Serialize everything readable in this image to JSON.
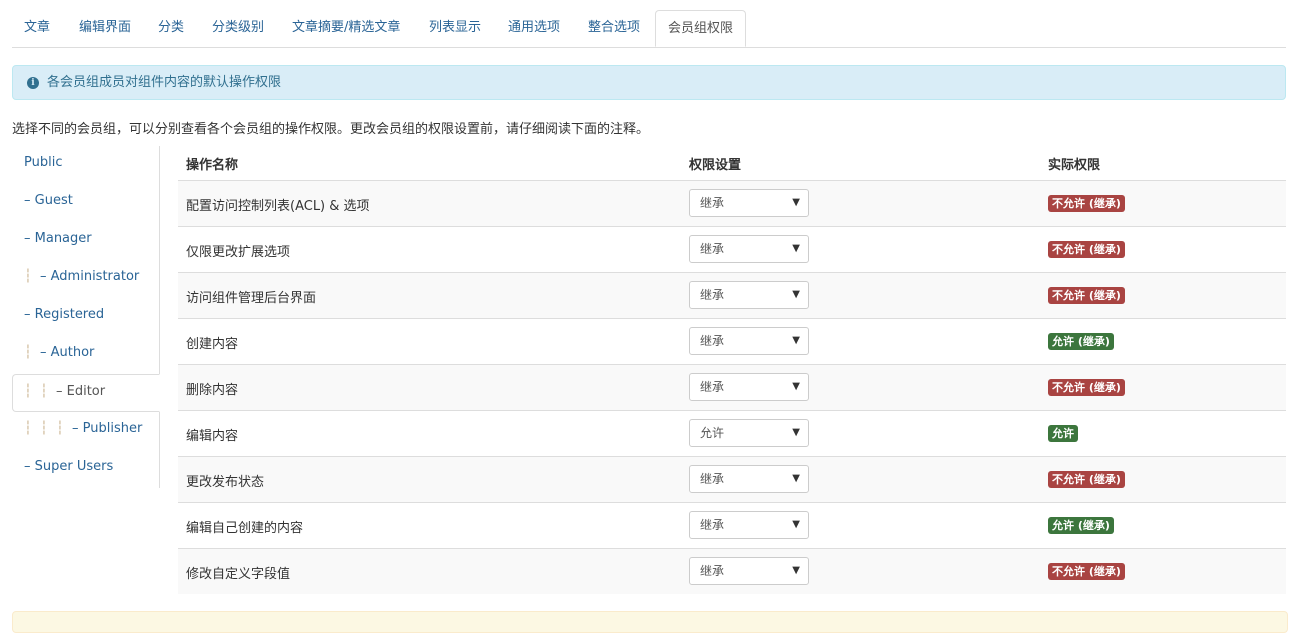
{
  "tabs": [
    "文章",
    "编辑界面",
    "分类",
    "分类级别",
    "文章摘要/精选文章",
    "列表显示",
    "通用选项",
    "整合选项",
    "会员组权限"
  ],
  "alert": {
    "icon": "info-icon",
    "text": "各会员组成员对组件内容的默认操作权限"
  },
  "description": "选择不同的会员组，可以分别查看各个会员组的操作权限。更改会员组的权限设置前，请仔细阅读下面的注释。",
  "groups": [
    {
      "label": "Public",
      "level": 0
    },
    {
      "label": "– Guest",
      "level": 0
    },
    {
      "label": "– Manager",
      "level": 0
    },
    {
      "label": "– Administrator",
      "level": 1
    },
    {
      "label": "– Registered",
      "level": 0
    },
    {
      "label": "– Author",
      "level": 1
    },
    {
      "label": "– Editor",
      "level": 2
    },
    {
      "label": "– Publisher",
      "level": 3
    },
    {
      "label": "– Super Users",
      "level": 0
    }
  ],
  "table": {
    "headers": {
      "action": "操作名称",
      "setting": "权限设置",
      "actual": "实际权限"
    },
    "rows": [
      {
        "action": "配置访问控制列表(ACL) & 选项",
        "setting": "继承",
        "actual": "不允许 (继承)",
        "status": "deny"
      },
      {
        "action": "仅限更改扩展选项",
        "setting": "继承",
        "actual": "不允许 (继承)",
        "status": "deny"
      },
      {
        "action": "访问组件管理后台界面",
        "setting": "继承",
        "actual": "不允许 (继承)",
        "status": "deny"
      },
      {
        "action": "创建内容",
        "setting": "继承",
        "actual": "允许 (继承)",
        "status": "allow"
      },
      {
        "action": "删除内容",
        "setting": "继承",
        "actual": "不允许 (继承)",
        "status": "deny"
      },
      {
        "action": "编辑内容",
        "setting": "允许",
        "actual": "允许",
        "status": "allow"
      },
      {
        "action": "更改发布状态",
        "setting": "继承",
        "actual": "不允许 (继承)",
        "status": "deny"
      },
      {
        "action": "编辑自己创建的内容",
        "setting": "继承",
        "actual": "允许 (继承)",
        "status": "allow"
      },
      {
        "action": "修改自定义字段值",
        "setting": "继承",
        "actual": "不允许 (继承)",
        "status": "deny"
      }
    ]
  },
  "colors": {
    "link": "#2a6496",
    "deny": "#a94442",
    "allow": "#3c763d",
    "info_bg": "#d9edf7"
  }
}
